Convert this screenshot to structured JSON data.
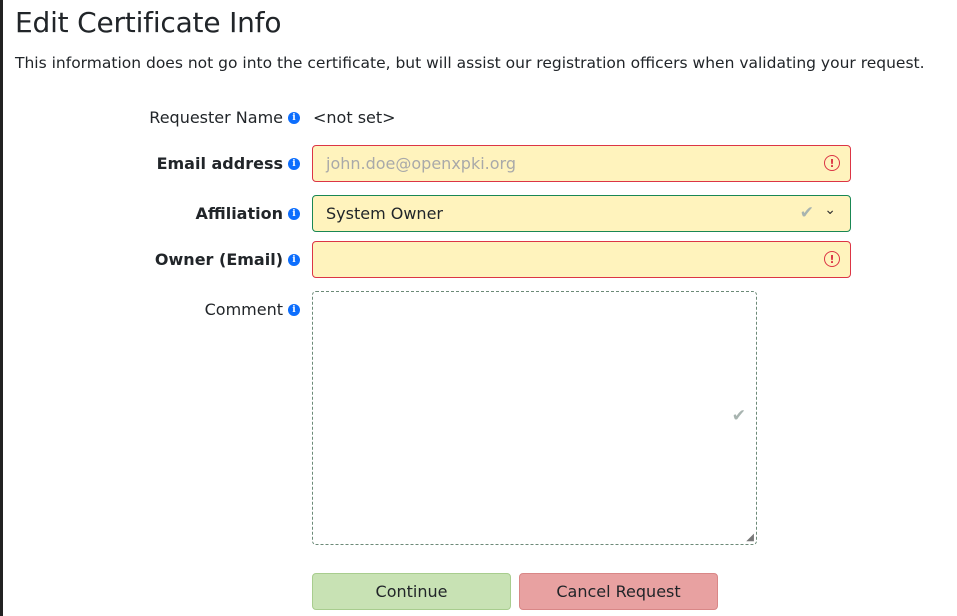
{
  "page": {
    "title": "Edit Certificate Info",
    "description": "This information does not go into the certificate, but will assist our registration officers when validating your request."
  },
  "form": {
    "requester": {
      "label": "Requester Name",
      "value": "<not set>"
    },
    "email": {
      "label": "Email address",
      "placeholder": "john.doe@openxpki.org",
      "value": ""
    },
    "affiliation": {
      "label": "Affiliation",
      "value": "System Owner"
    },
    "owner": {
      "label": "Owner (Email)",
      "value": ""
    },
    "comment": {
      "label": "Comment",
      "value": ""
    }
  },
  "buttons": {
    "continue": "Continue",
    "cancel": "Cancel Request"
  },
  "icons": {
    "info": "i",
    "alert": "!",
    "check": "✔",
    "chevron": "⌄"
  },
  "colors": {
    "invalid_border": "#dc3545",
    "field_bg": "#fff3bd",
    "continue_bg": "#c8e2b4",
    "cancel_bg": "#e8a1a1"
  }
}
